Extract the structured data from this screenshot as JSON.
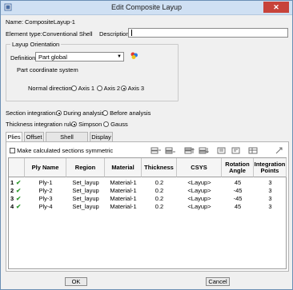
{
  "window": {
    "title": "Edit Composite Layup",
    "close_symbol": "✕"
  },
  "header": {
    "name_label": "Name:",
    "name_value": "CompositeLayup-1",
    "element_type_label": "Element type:",
    "element_type_value": "Conventional Shell",
    "description_label": "Description:",
    "description_value": ""
  },
  "orientation": {
    "group_title": "Layup Orientation",
    "definition_label": "Definition:",
    "definition_value": "Part global",
    "coord_text": "Part coordinate system",
    "normal_label": "Normal direction:",
    "axes": [
      "Axis 1",
      "Axis 2",
      "Axis 3"
    ],
    "selected_axis": "Axis 3"
  },
  "section_integration": {
    "label": "Section integration:",
    "options": [
      "During analysis",
      "Before analysis"
    ],
    "selected": "During analysis"
  },
  "thickness_rule": {
    "label": "Thickness integration rule:",
    "options": [
      "Simpson",
      "Gauss"
    ],
    "selected": "Simpson"
  },
  "tabs": [
    "Plies",
    "Offset",
    "Shell Parameters",
    "Display"
  ],
  "active_tab": "Plies",
  "symmetric_label": "Make calculated sections symmetric",
  "table": {
    "headers": [
      "Ply Name",
      "Region",
      "Material",
      "Thickness",
      "CSYS",
      "Rotation\nAngle",
      "Integration\nPoints"
    ],
    "rows": [
      {
        "idx": "1",
        "ply": "Ply-1",
        "region": "Set_layup",
        "material": "Material-1",
        "thickness": "0.2",
        "csys": "<Layup>",
        "angle": "45",
        "points": "3"
      },
      {
        "idx": "2",
        "ply": "Ply-2",
        "region": "Set_layup",
        "material": "Material-1",
        "thickness": "0.2",
        "csys": "<Layup>",
        "angle": "-45",
        "points": "3"
      },
      {
        "idx": "3",
        "ply": "Ply-3",
        "region": "Set_layup",
        "material": "Material-1",
        "thickness": "0.2",
        "csys": "<Layup>",
        "angle": "-45",
        "points": "3"
      },
      {
        "idx": "4",
        "ply": "Ply-4",
        "region": "Set_layup",
        "material": "Material-1",
        "thickness": "0.2",
        "csys": "<Layup>",
        "angle": "45",
        "points": "3"
      }
    ]
  },
  "buttons": {
    "ok": "OK",
    "cancel": "Cancel"
  },
  "colors": {
    "check": "#2f9a2f",
    "title_bar": "#cfe0f3",
    "close": "#c7433a"
  }
}
